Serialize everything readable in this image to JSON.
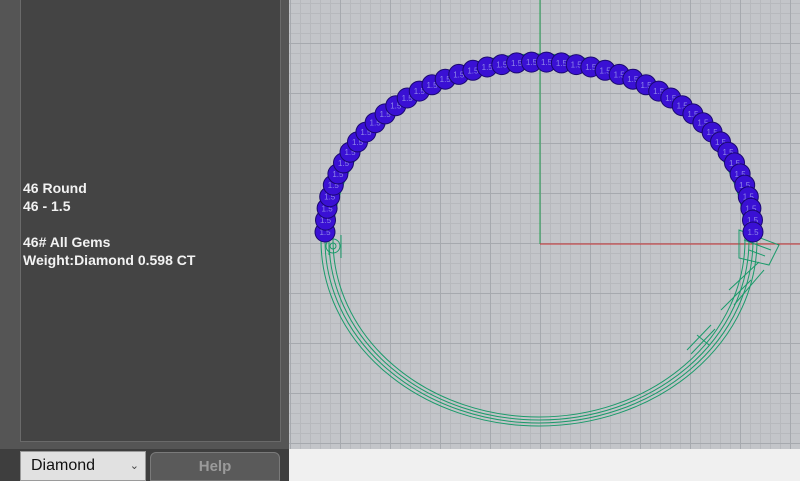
{
  "gem_info": {
    "line1": "46 Round",
    "line2": "46 - 1.5",
    "line3": "46# All Gems",
    "line4": "Weight:Diamond 0.598 CT"
  },
  "controls": {
    "material_value": "Diamond",
    "help_label": "Help"
  },
  "gems": {
    "count": 46,
    "size_label": "1.5",
    "color": "#3a10d4"
  },
  "colors": {
    "ring_wire": "#1a9a6a",
    "x_axis": "#c83030",
    "y_axis": "#20a050",
    "grid": "#a6a9ae"
  }
}
